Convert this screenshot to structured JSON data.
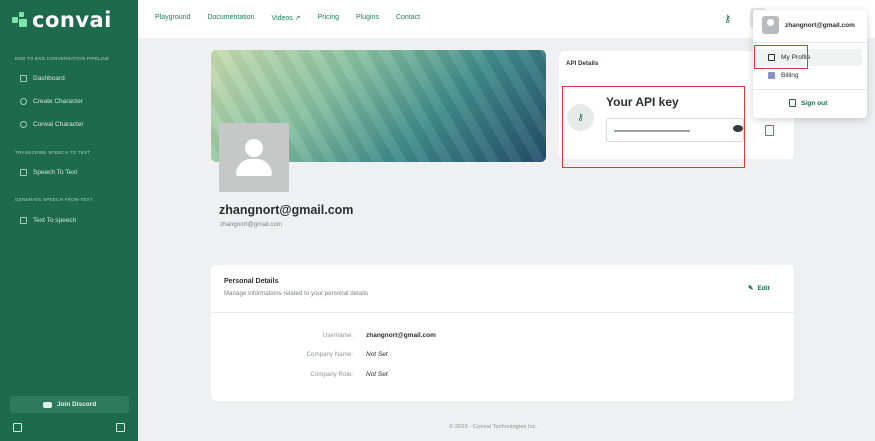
{
  "sidebar": {
    "logo": "convai",
    "sections": [
      {
        "title": "END TO END CONVERSATION PIPELINE",
        "items": [
          "Dashboard",
          "Create Character",
          "Convai Character"
        ]
      },
      {
        "title": "TRANSCRIBE SPEECH TO TEXT",
        "items": [
          "Speech To Text"
        ]
      },
      {
        "title": "GENERATE SPEECH FROM TEXT",
        "items": [
          "Text To speech"
        ]
      }
    ],
    "join_discord": "Join Discord"
  },
  "topnav": {
    "items": [
      "Playground",
      "Documentation",
      "Videos ↗",
      "Pricing",
      "Plugins",
      "Contact"
    ]
  },
  "profile": {
    "name": "zhangnort@gmail.com",
    "email": "zhangnort@gmail.com"
  },
  "api": {
    "header": "API Details",
    "title": "Your API key"
  },
  "personal": {
    "title": "Personal Details",
    "subtitle": "Manage informations related to your personal details",
    "edit": "Edit",
    "rows": [
      {
        "label": "Username:",
        "value": "zhangnort@gmail.com"
      },
      {
        "label": "Company Name:",
        "value": "Not Set"
      },
      {
        "label": "Company Role:",
        "value": "Not Set"
      }
    ]
  },
  "dropdown": {
    "email": "zhangnort@gmail.com",
    "items": [
      "My Profile",
      "Billing"
    ],
    "signout": "Sign out"
  },
  "footer": "© 2023 - Convai Technologies Inc.",
  "colors": {
    "brand": "#1d6b4c",
    "accent": "#7ee3a8",
    "highlight": "#d93a3a"
  }
}
